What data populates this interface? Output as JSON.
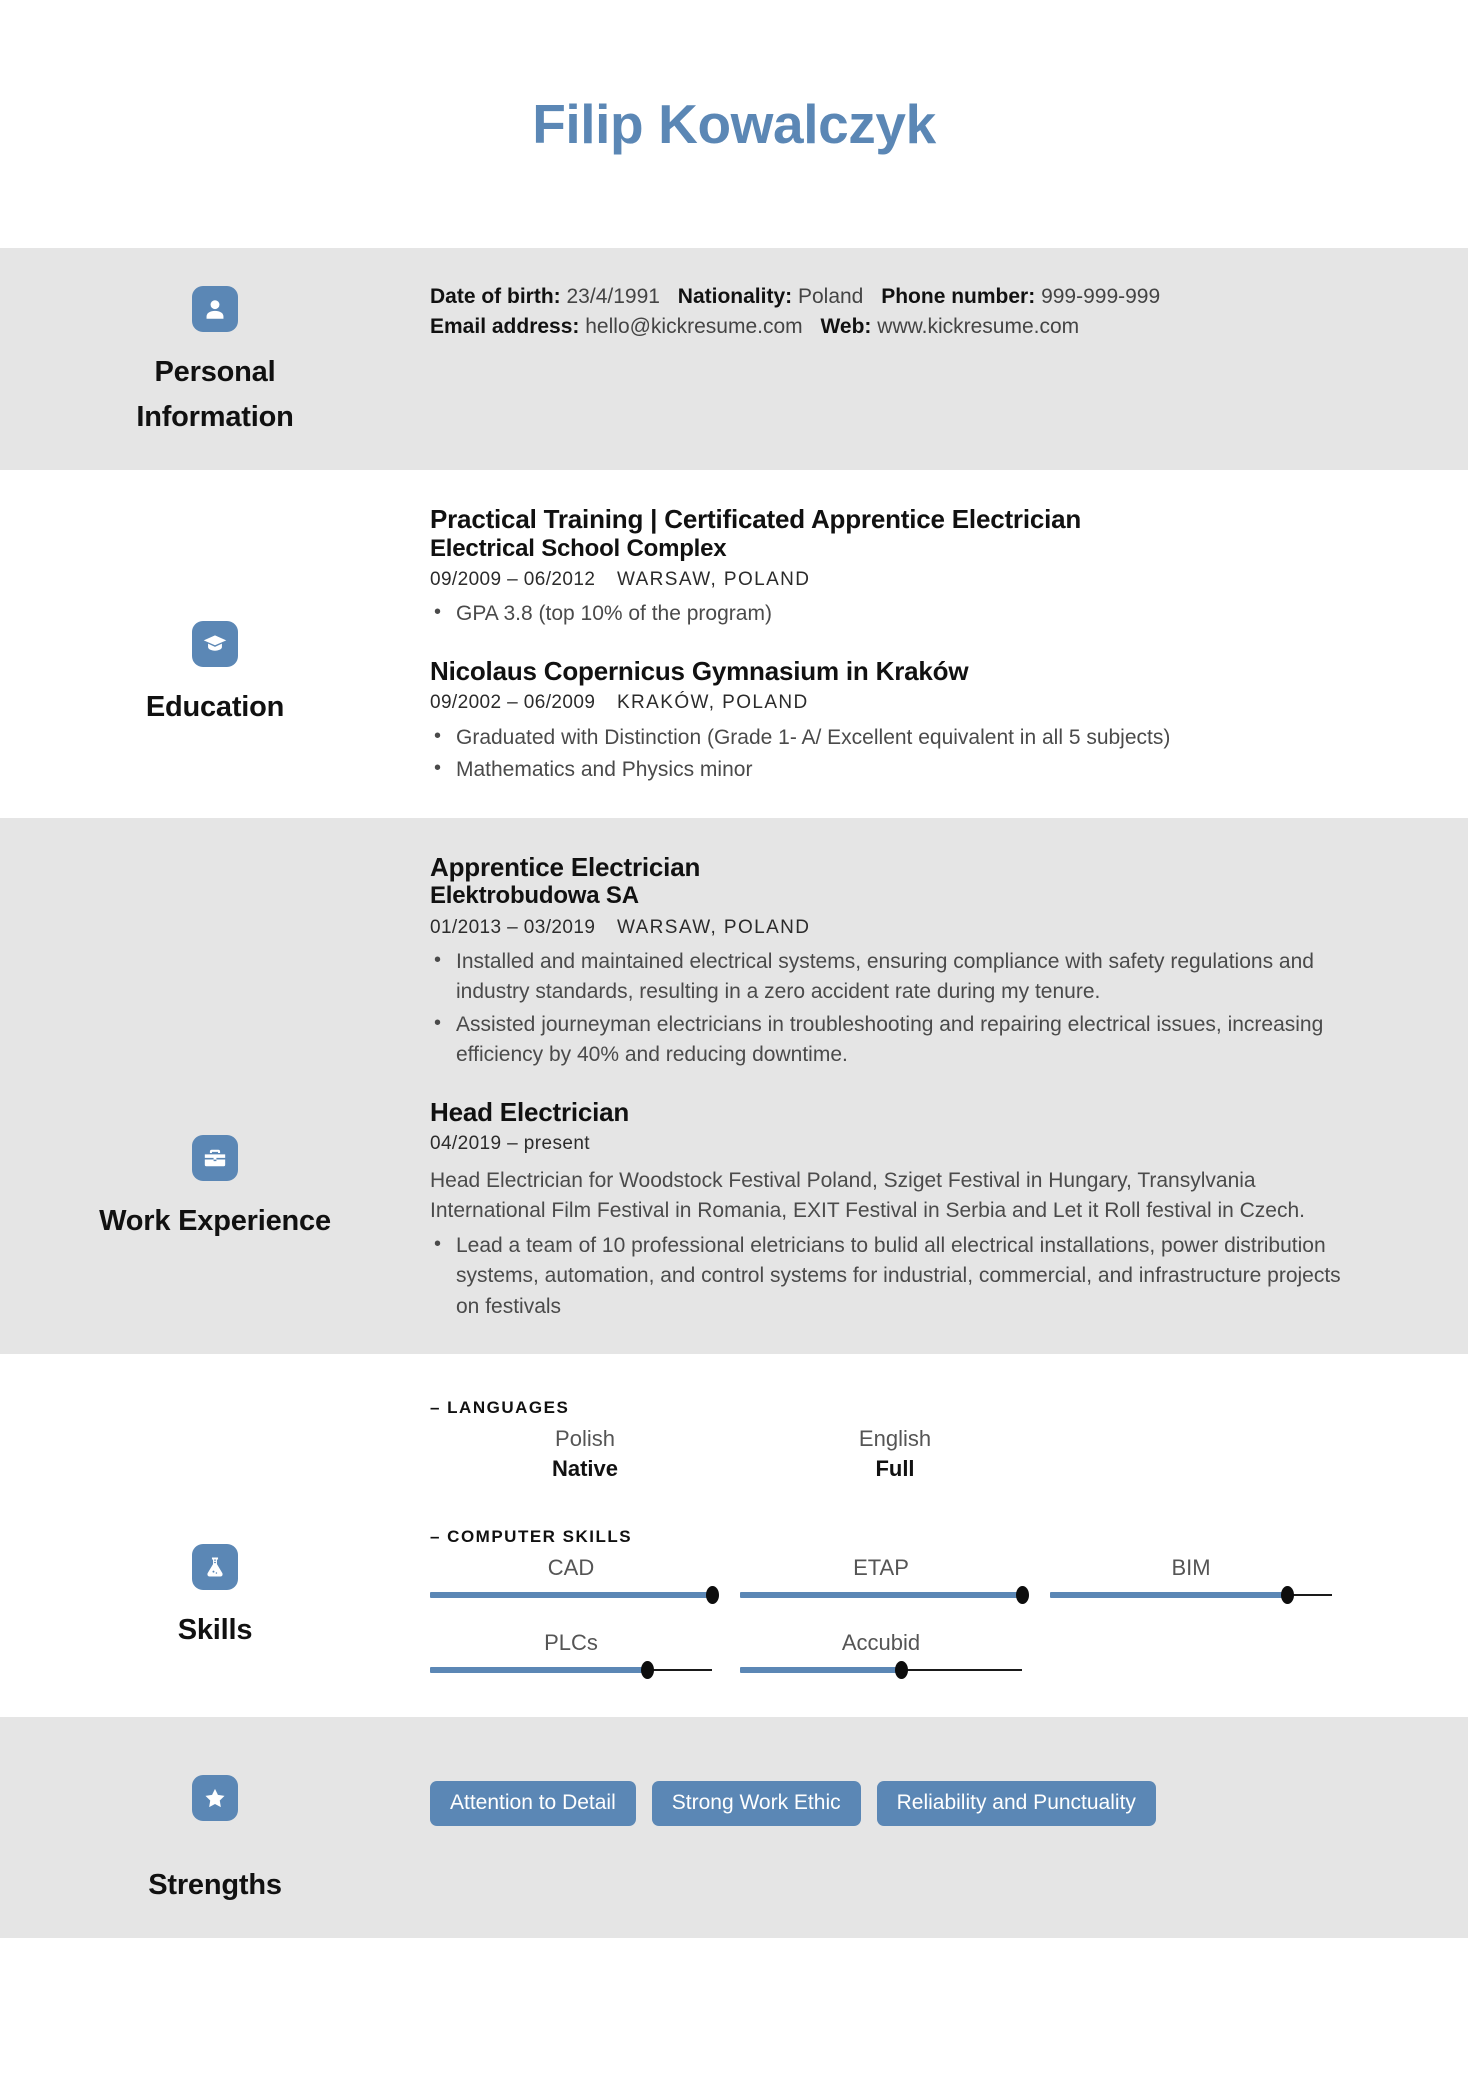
{
  "header": {
    "name": "Filip Kowalczyk",
    "accent_color": "#5b87b5"
  },
  "sections": {
    "personal": {
      "label": "Personal\nInformation",
      "label_line1": "Personal",
      "label_line2": "Information",
      "icon": "person-icon",
      "fields": [
        {
          "label": "Date of birth:",
          "value": "23/4/1991"
        },
        {
          "label": "Nationality:",
          "value": "Poland"
        },
        {
          "label": "Phone number:",
          "value": "999-999-999"
        },
        {
          "label": "Email address:",
          "value": "hello@kickresume.com"
        },
        {
          "label": "Web:",
          "value": "www.kickresume.com"
        }
      ]
    },
    "education": {
      "label": "Education",
      "icon": "graduation-cap-icon",
      "entries": [
        {
          "title": "Practical Training | Certificated Apprentice Electrician",
          "subtitle": "Electrical School Complex",
          "dates": "09/2009 – 06/2012",
          "location": "WARSAW, POLAND",
          "bullets": [
            "GPA 3.8 (top 10% of the program)"
          ]
        },
        {
          "title": "Nicolaus Copernicus Gymnasium in Kraków",
          "subtitle": "",
          "dates": "09/2002 – 06/2009",
          "location": "KRAKÓW, POLAND",
          "bullets": [
            "Graduated with Distinction (Grade 1- A/ Excellent  equivalent in all 5 subjects)",
            "Mathematics and Physics minor"
          ]
        }
      ]
    },
    "work": {
      "label": "Work Experience",
      "icon": "briefcase-icon",
      "entries": [
        {
          "title": "Apprentice Electrician",
          "subtitle": "Elektrobudowa SA",
          "dates": "01/2013 – 03/2019",
          "location": "WARSAW, POLAND",
          "description": "",
          "bullets": [
            "Installed and maintained electrical systems, ensuring compliance with safety regulations and industry standards, resulting in a zero accident rate during my tenure.",
            "Assisted journeyman electricians in troubleshooting and repairing electrical issues, increasing efficiency by 40% and reducing downtime."
          ]
        },
        {
          "title": "Head Electrician",
          "subtitle": "",
          "dates": "04/2019 – present",
          "location": "",
          "description": "Head Electrician for Woodstock Festival Poland, Sziget Festival in Hungary, Transylvania International Film Festival in Romania, EXIT Festival in Serbia and Let it Roll festival in Czech.",
          "bullets": [
            "Lead a team of 10 professional eletricians to bulid all electrical installations, power distribution systems, automation, and control systems for industrial, commercial, and infrastructure projects on festivals"
          ]
        }
      ]
    },
    "skills": {
      "label": "Skills",
      "icon": "flask-icon",
      "languages_title": "– LANGUAGES",
      "languages": [
        {
          "name": "Polish",
          "level": "Native"
        },
        {
          "name": "English",
          "level": "Full"
        }
      ],
      "computer_title": "– COMPUTER SKILLS",
      "computer_skills": [
        {
          "name": "CAD",
          "value": 100
        },
        {
          "name": "ETAP",
          "value": 100
        },
        {
          "name": "BIM",
          "value": 84
        },
        {
          "name": "PLCs",
          "value": 77
        },
        {
          "name": "Accubid",
          "value": 57
        }
      ]
    },
    "strengths": {
      "label": "Strengths",
      "icon": "star-icon",
      "items": [
        "Attention to Detail",
        "Strong Work Ethic",
        "Reliability and Punctuality"
      ]
    }
  }
}
